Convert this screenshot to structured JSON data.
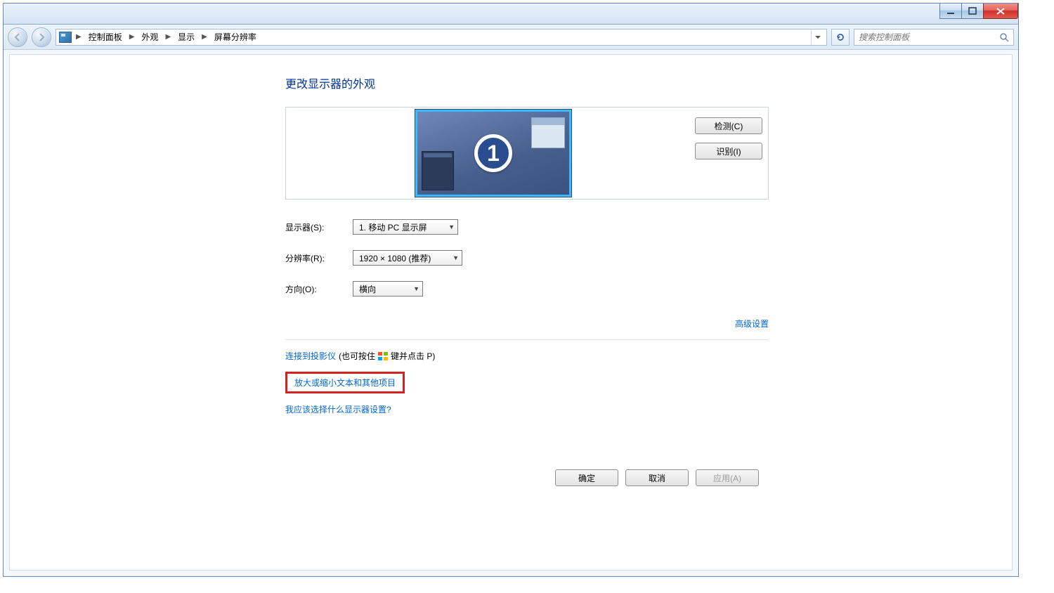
{
  "breadcrumb": {
    "items": [
      "控制面板",
      "外观",
      "显示",
      "屏幕分辨率"
    ]
  },
  "search": {
    "placeholder": "搜索控制面板"
  },
  "page": {
    "title": "更改显示器的外观",
    "monitor_number": "1",
    "detect_btn": "检测(C)",
    "identify_btn": "识别(I)"
  },
  "fields": {
    "display": {
      "label": "显示器(S):",
      "value": "1. 移动 PC 显示屏"
    },
    "resolution": {
      "label": "分辨率(R):",
      "value": "1920 × 1080 (推荐)"
    },
    "orientation": {
      "label": "方向(O):",
      "value": "横向"
    }
  },
  "links": {
    "advanced": "高级设置",
    "projector": "连接到投影仪",
    "projector_hint_pre": "(也可按住",
    "projector_hint_post": "键并点击 P)",
    "text_size": "放大或缩小文本和其他项目",
    "help": "我应该选择什么显示器设置?"
  },
  "buttons": {
    "ok": "确定",
    "cancel": "取消",
    "apply": "应用(A)"
  }
}
